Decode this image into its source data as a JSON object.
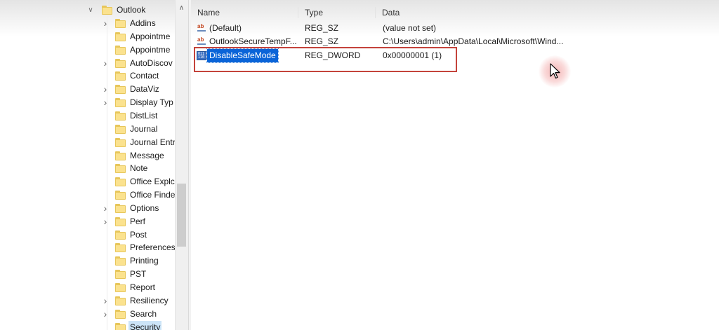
{
  "tree": {
    "parent": {
      "label": "Outlook",
      "expanded": true
    },
    "items": [
      {
        "label": "Addins",
        "expandable": true
      },
      {
        "label": "Appointme",
        "expandable": false
      },
      {
        "label": "Appointme",
        "expandable": false
      },
      {
        "label": "AutoDiscov",
        "expandable": true
      },
      {
        "label": "Contact",
        "expandable": false
      },
      {
        "label": "DataViz",
        "expandable": true
      },
      {
        "label": "Display Typ",
        "expandable": true
      },
      {
        "label": "DistList",
        "expandable": false
      },
      {
        "label": "Journal",
        "expandable": false
      },
      {
        "label": "Journal Entr",
        "expandable": false
      },
      {
        "label": "Message",
        "expandable": false
      },
      {
        "label": "Note",
        "expandable": false
      },
      {
        "label": "Office Explc",
        "expandable": false
      },
      {
        "label": "Office Finde",
        "expandable": false
      },
      {
        "label": "Options",
        "expandable": true
      },
      {
        "label": "Perf",
        "expandable": true
      },
      {
        "label": "Post",
        "expandable": false
      },
      {
        "label": "Preferences",
        "expandable": false
      },
      {
        "label": "Printing",
        "expandable": false
      },
      {
        "label": "PST",
        "expandable": false
      },
      {
        "label": "Report",
        "expandable": false
      },
      {
        "label": "Resiliency",
        "expandable": true
      },
      {
        "label": "Search",
        "expandable": true
      },
      {
        "label": "Security",
        "expandable": false,
        "selected": true
      }
    ]
  },
  "list": {
    "columns": {
      "name": "Name",
      "type": "Type",
      "data": "Data"
    },
    "rows": [
      {
        "icon": "string-value-icon",
        "name": "(Default)",
        "type": "REG_SZ",
        "data": "(value not set)"
      },
      {
        "icon": "string-value-icon",
        "name": "OutlookSecureTempF...",
        "type": "REG_SZ",
        "data": "C:\\Users\\admin\\AppData\\Local\\Microsoft\\Wind..."
      },
      {
        "icon": "dword-value-icon",
        "name": "DisableSafeMode",
        "type": "REG_DWORD",
        "data": "0x00000001 (1)",
        "selected": true
      }
    ]
  },
  "colors": {
    "highlight_box": "#c4433b",
    "selection": "#0a64d8",
    "folder": "#fbe28e"
  }
}
